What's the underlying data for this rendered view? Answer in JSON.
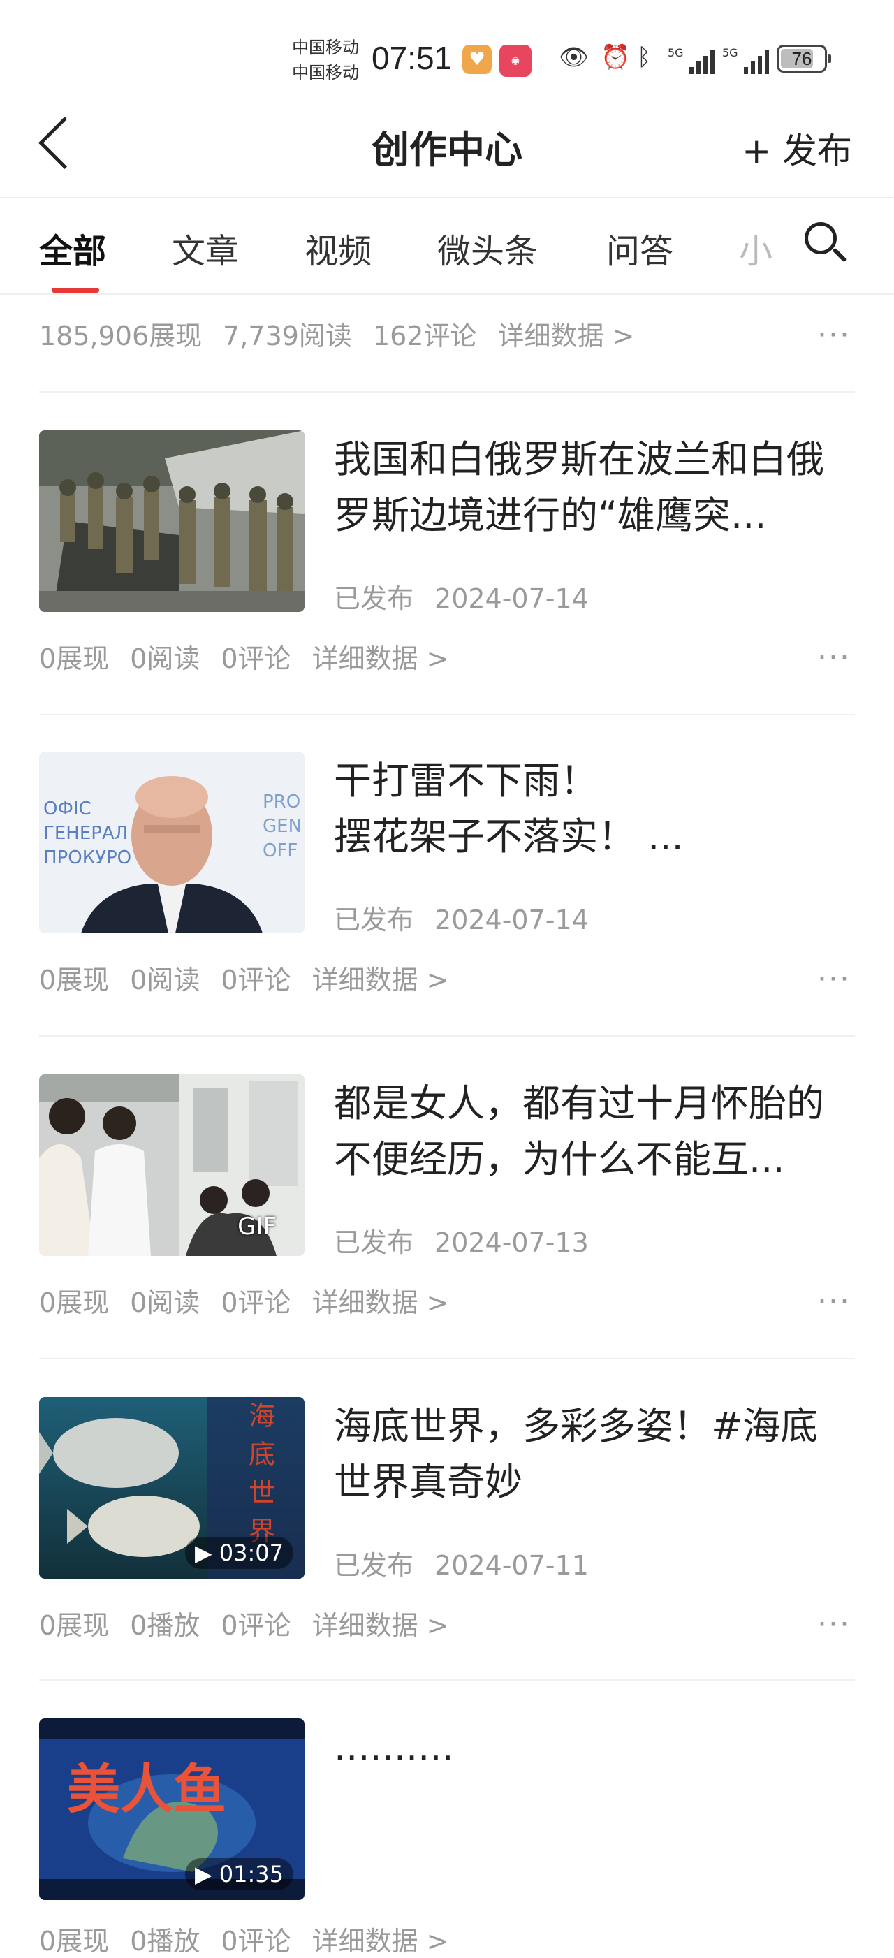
{
  "status_bar": {
    "carrier_1": "中国移动",
    "carrier_2": "中国移动",
    "time": "07:51",
    "battery": "76",
    "signal_1": "5G",
    "signal_2": "5G"
  },
  "header": {
    "title": "创作中心",
    "publish_label": "+ 发布"
  },
  "tabs": [
    {
      "label": "全部",
      "active": true
    },
    {
      "label": "文章"
    },
    {
      "label": "视频"
    },
    {
      "label": "微头条"
    },
    {
      "label": "问答"
    },
    {
      "label": "小"
    }
  ],
  "top_stats": {
    "impressions": "185,906展现",
    "reads": "7,739阅读",
    "comments": "162评论",
    "detail": "详细数据 >"
  },
  "articles": [
    {
      "title": "我国和白俄罗斯在波兰和白俄罗斯边境进行的“雄鹰突...",
      "status": "已发布",
      "date": "2024-07-14",
      "stats": [
        "0展现",
        "0阅读",
        "0评论"
      ],
      "detail": "详细数据 >"
    },
    {
      "title": "干打雷不下雨！\n摆花架子不落实！ ...",
      "status": "已发布",
      "date": "2024-07-14",
      "stats": [
        "0展现",
        "0阅读",
        "0评论"
      ],
      "detail": "详细数据 >"
    },
    {
      "title": "都是女人，都有过十月怀胎的不便经历，为什么不能互...",
      "status": "已发布",
      "date": "2024-07-13",
      "badge": "GIF",
      "stats": [
        "0展现",
        "0阅读",
        "0评论"
      ],
      "detail": "详细数据 >"
    },
    {
      "title": "海底世界，多彩多姿！#海底世界真奇妙",
      "status": "已发布",
      "date": "2024-07-11",
      "duration": "03:07",
      "stats": [
        "0展现",
        "0播放",
        "0评论"
      ],
      "detail": "详细数据 >"
    },
    {
      "title": "..........",
      "thumb_text": "美人鱼",
      "duration": "01:35",
      "stats": [
        "0展现",
        "0播放",
        "0评论"
      ],
      "detail": "详细数据 >"
    }
  ],
  "thumb_overlays": {
    "card2_sign": "ОФІС\nГЕНЕРАЛ\nПРОКУРО",
    "card2_sign_right": "PRO\nGEN\nOFF",
    "card4_vertical": "海底世界"
  },
  "more_glyph": "···"
}
